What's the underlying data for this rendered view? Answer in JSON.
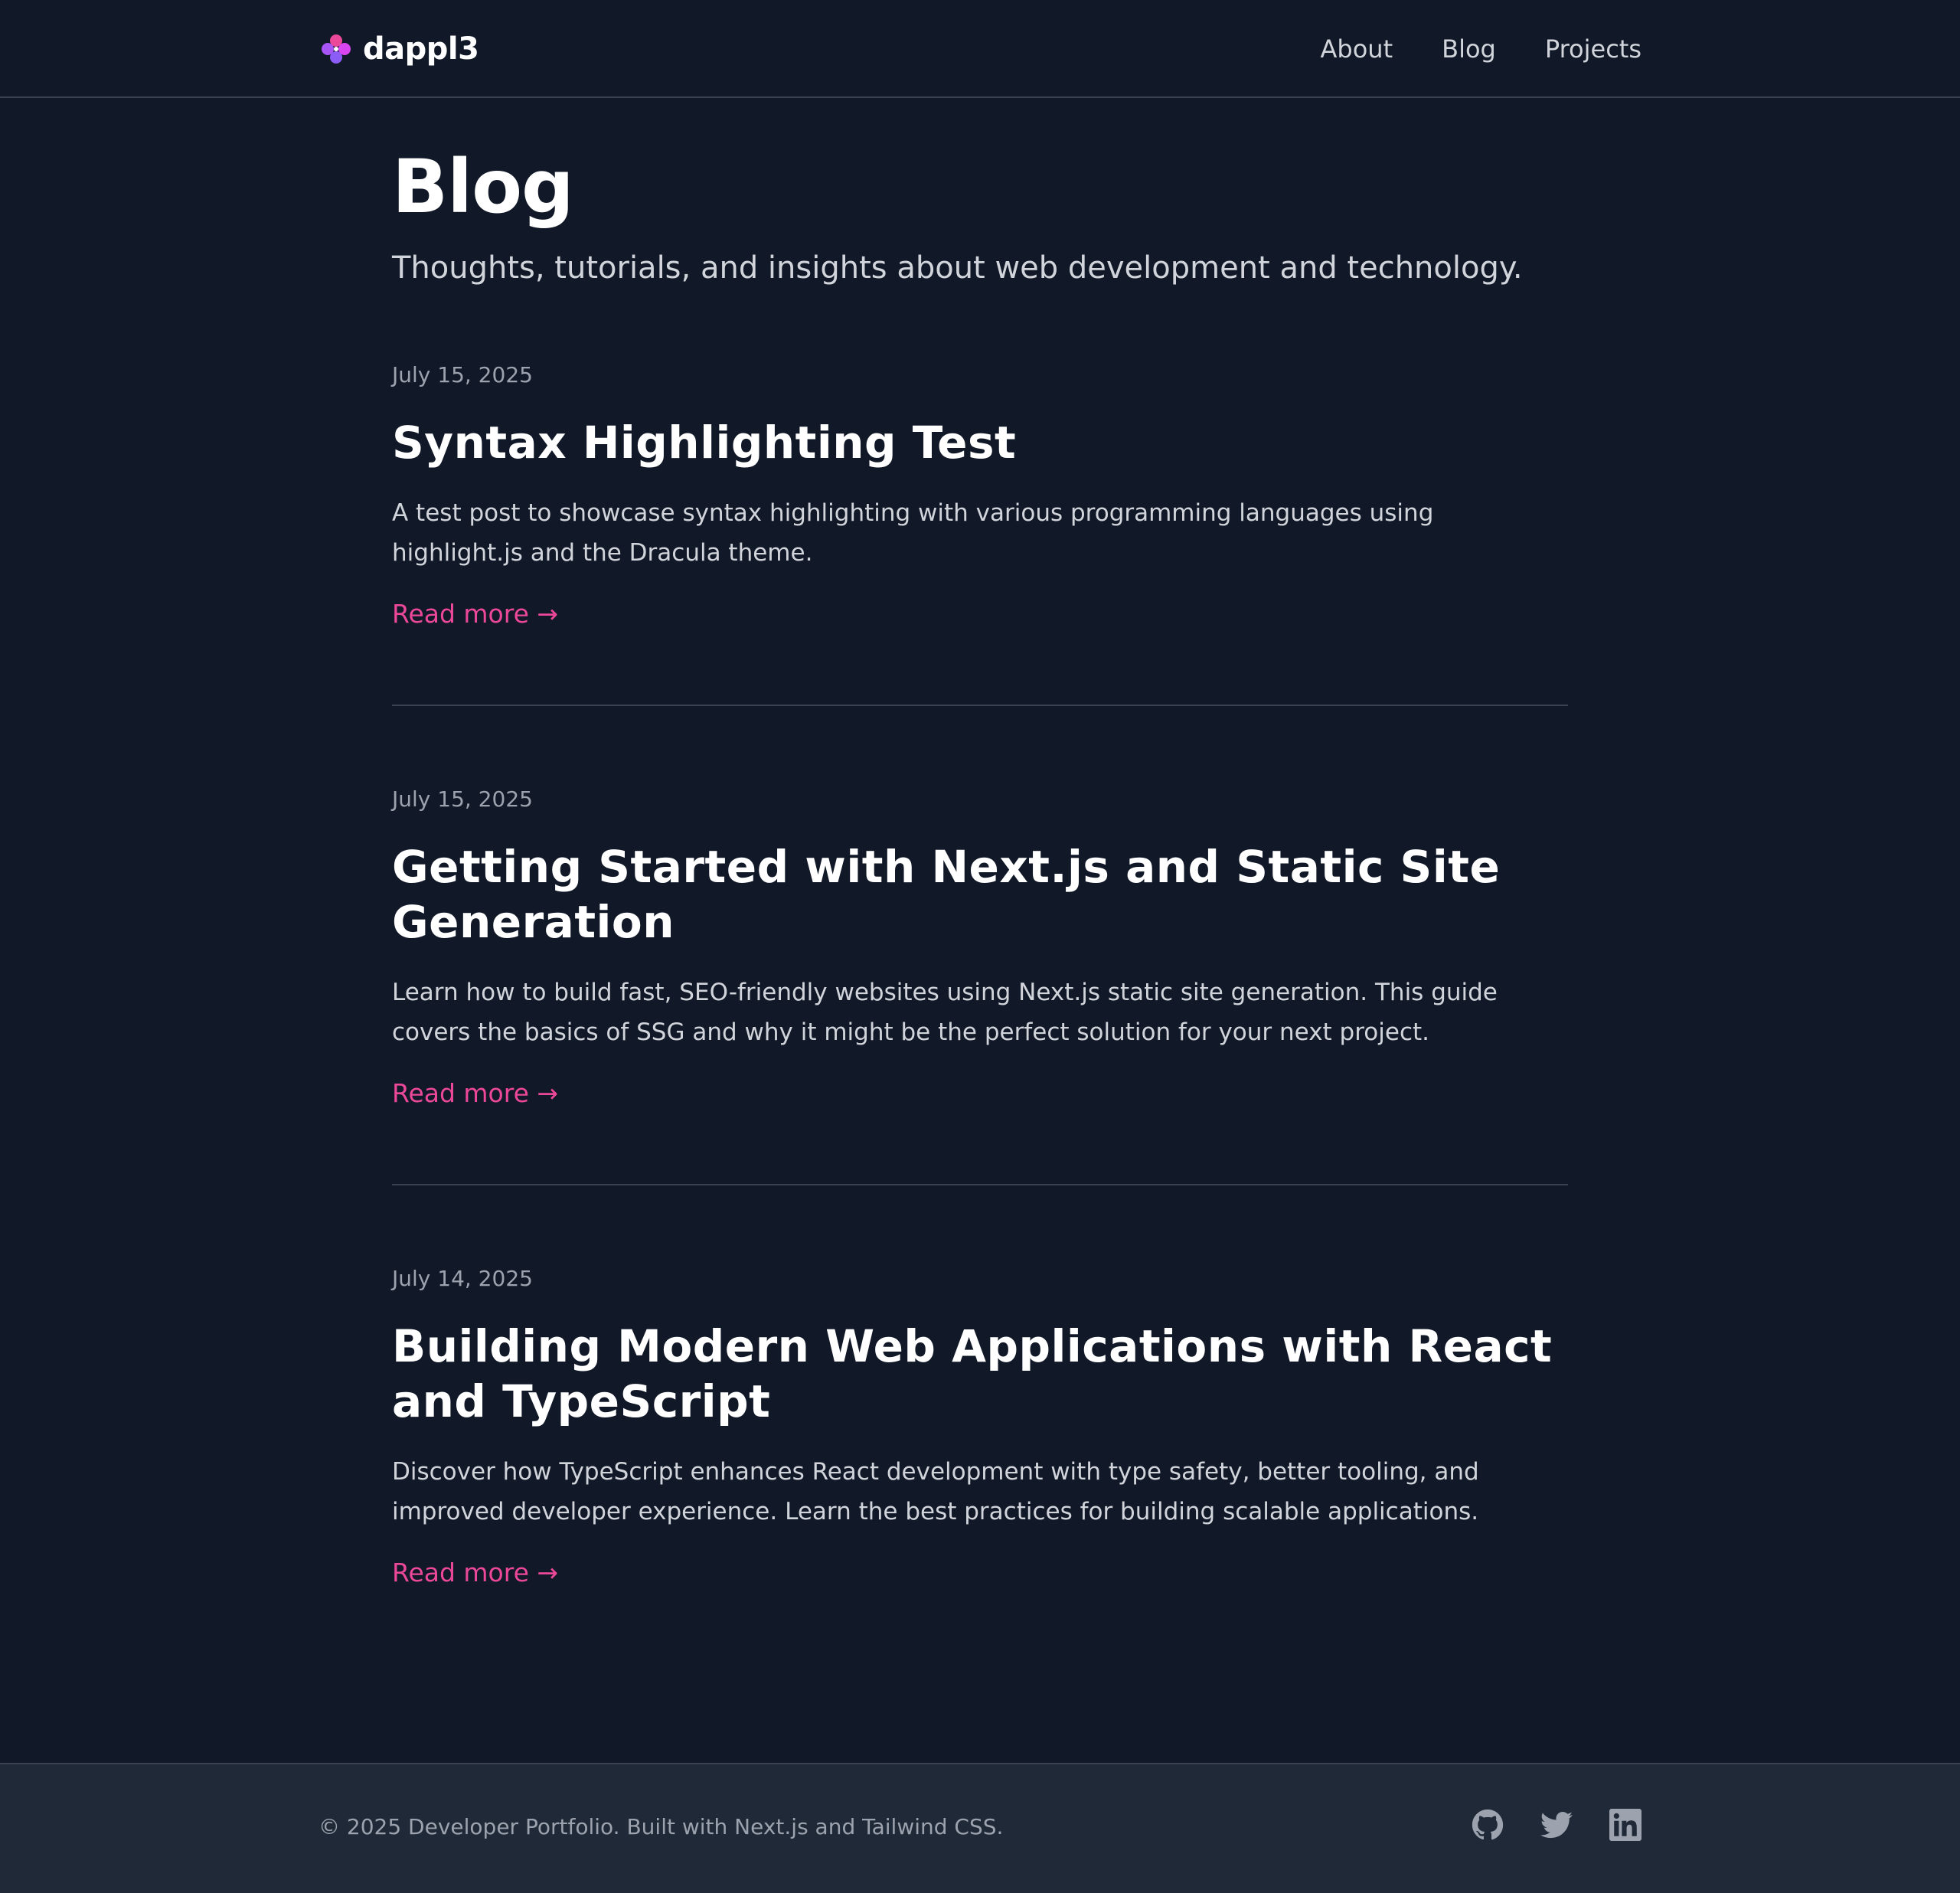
{
  "header": {
    "brand_name": "dappl3",
    "logo_icon": "flower-logo-icon",
    "nav": [
      {
        "label": "About"
      },
      {
        "label": "Blog"
      },
      {
        "label": "Projects"
      }
    ]
  },
  "page": {
    "title": "Blog",
    "subtitle": "Thoughts, tutorials, and insights about web development and technology."
  },
  "posts": [
    {
      "date": "July 15, 2025",
      "title": "Syntax Highlighting Test",
      "excerpt": "A test post to showcase syntax highlighting with various programming languages using highlight.js and the Dracula theme.",
      "read_more": "Read more →"
    },
    {
      "date": "July 15, 2025",
      "title": "Getting Started with Next.js and Static Site Generation",
      "excerpt": "Learn how to build fast, SEO-friendly websites using Next.js static site generation. This guide covers the basics of SSG and why it might be the perfect solution for your next project.",
      "read_more": "Read more →"
    },
    {
      "date": "July 14, 2025",
      "title": "Building Modern Web Applications with React and TypeScript",
      "excerpt": "Discover how TypeScript enhances React development with type safety, better tooling, and improved developer experience. Learn the best practices for building scalable applications.",
      "read_more": "Read more →"
    }
  ],
  "footer": {
    "copyright": "© 2025 Developer Portfolio. Built with Next.js and Tailwind CSS.",
    "socials": [
      "github-icon",
      "twitter-icon",
      "linkedin-icon"
    ]
  },
  "colors": {
    "background": "#111827",
    "footer_background": "#1f2937",
    "accent": "#ec4899",
    "border": "#374151",
    "muted_text": "#9ca3af",
    "body_text": "#d1d5db"
  }
}
